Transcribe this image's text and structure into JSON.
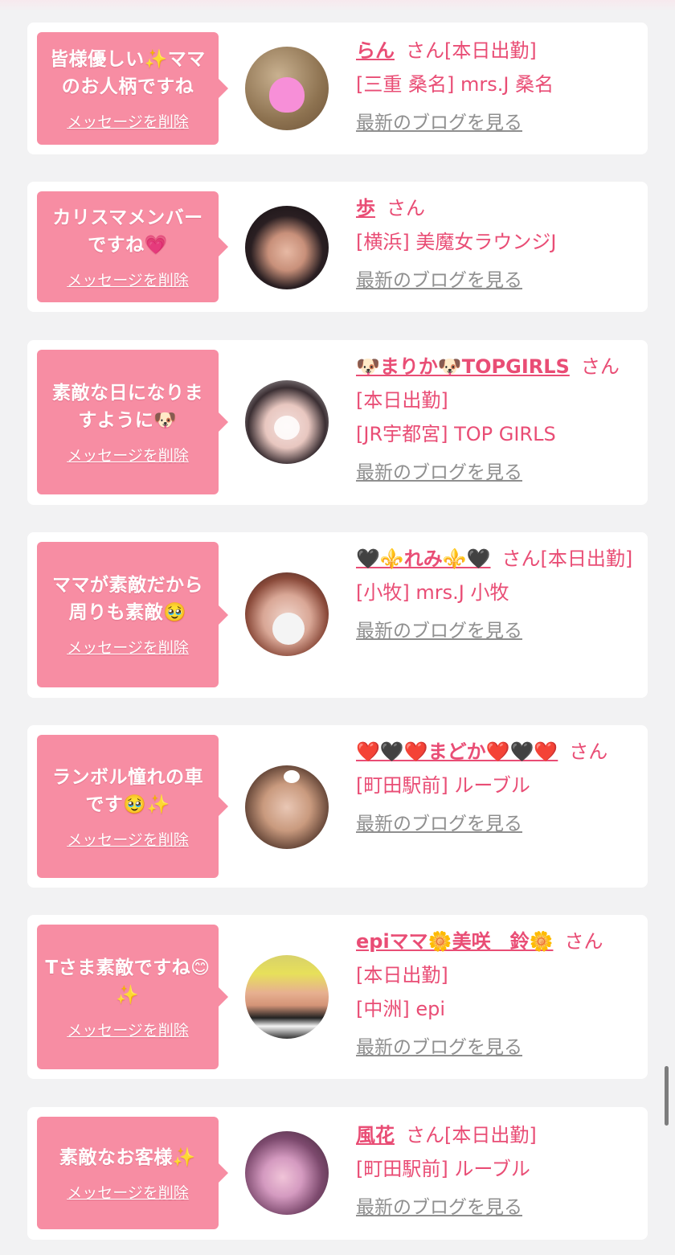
{
  "cards": [
    {
      "message": "皆様優しい✨ママのお人柄ですね",
      "delete_label": "メッセージを削除",
      "name": "らん",
      "honorific": "さん",
      "status": "[本日出勤]",
      "shop": "[三重 桑名] mrs.J 桑名",
      "blog_label": "最新のブログを見る"
    },
    {
      "message": "カリスマメンバーですね💗",
      "delete_label": "メッセージを削除",
      "name": "歩",
      "honorific": "さん",
      "status": "",
      "shop": "[横浜] 美魔女ラウンジJ",
      "blog_label": "最新のブログを見る"
    },
    {
      "message": "素敵な日になりますように🐶",
      "delete_label": "メッセージを削除",
      "name": "🐶まりか🐶TOPGIRLS",
      "honorific": "さん",
      "status": "[本日出勤]",
      "shop": "[JR宇都宮] TOP GIRLS",
      "blog_label": "最新のブログを見る"
    },
    {
      "message": "ママが素敵だから周りも素敵🥹",
      "delete_label": "メッセージを削除",
      "name": "🖤⚜️れみ⚜️🖤",
      "honorific": "さん",
      "status": "[本日出勤]",
      "shop": "[小牧] mrs.J 小牧",
      "blog_label": "最新のブログを見る"
    },
    {
      "message": "ランボル憧れの車です🥹✨",
      "delete_label": "メッセージを削除",
      "name": "❤️🖤❤️まどか❤️🖤❤️",
      "honorific": "さん",
      "status": "",
      "shop": "[町田駅前] ルーブル",
      "blog_label": "最新のブログを見る"
    },
    {
      "message": "Tさま素敵ですね😊✨",
      "delete_label": "メッセージを削除",
      "name": "epiママ🌼美咲　鈴🌼",
      "honorific": "さん",
      "status": "[本日出勤]",
      "shop": "[中洲] epi",
      "blog_label": "最新のブログを見る"
    },
    {
      "message": "素敵なお客様✨",
      "delete_label": "メッセージを削除",
      "name": "風花",
      "honorific": "さん",
      "status": "[本日出勤]",
      "shop": "[町田駅前] ルーブル",
      "blog_label": "最新のブログを見る"
    }
  ],
  "colors": {
    "background": "#f2f2f3",
    "bubble": "#f78da3",
    "accent_text": "#e94d75",
    "muted_link": "#8f8f8f",
    "card": "#ffffff"
  }
}
